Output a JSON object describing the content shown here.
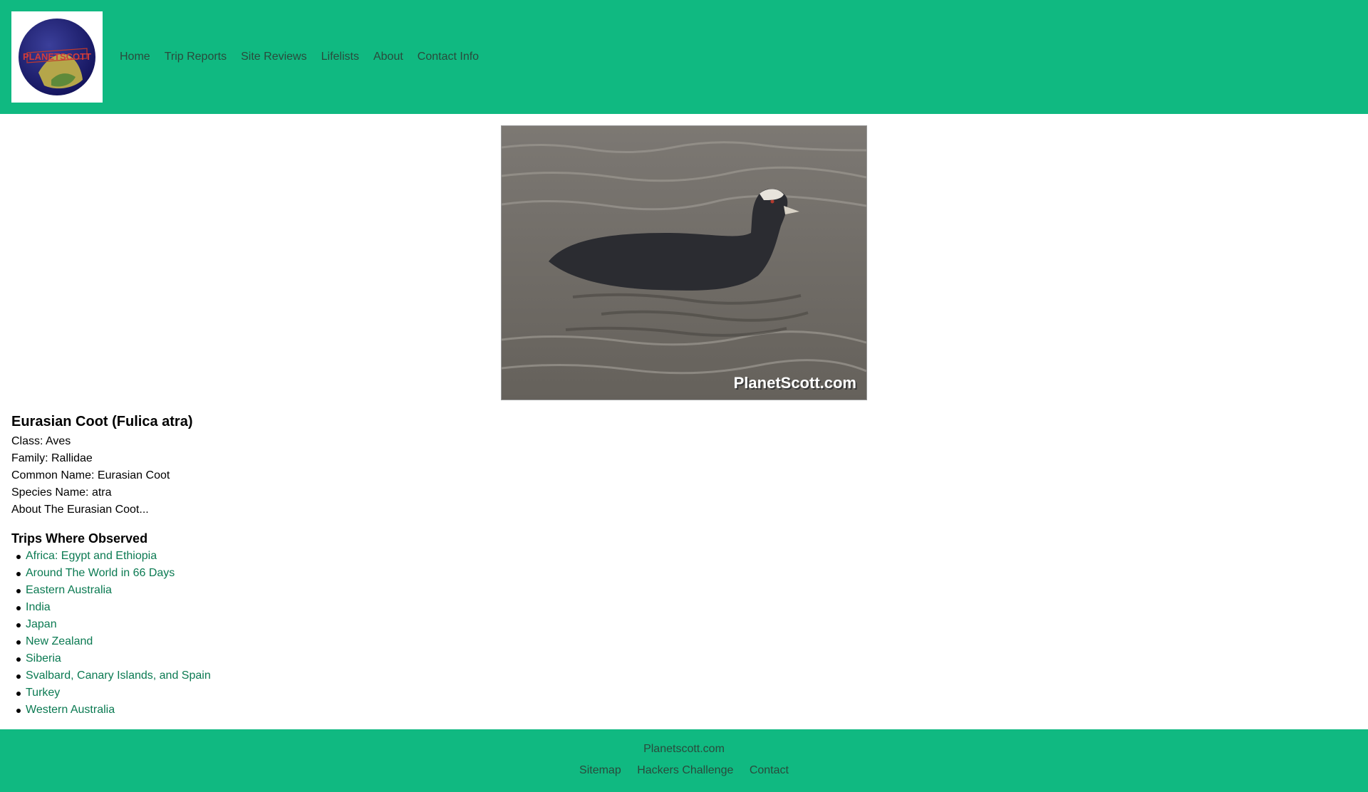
{
  "header": {
    "logo_alt": "PlanetScott",
    "nav": [
      "Home",
      "Trip Reports",
      "Site Reviews",
      "Lifelists",
      "About",
      "Contact Info"
    ]
  },
  "photo": {
    "alt": "Eurasian Coot",
    "watermark": "PlanetScott.com"
  },
  "species": {
    "title": "Eurasian Coot (Fulica atra)",
    "class": "Class: Aves",
    "family": "Family: Rallidae",
    "common_name": "Common Name: Eurasian Coot",
    "species_name": "Species Name: atra",
    "about": "About The Eurasian Coot..."
  },
  "trips": {
    "title": "Trips Where Observed",
    "items": [
      "Africa: Egypt and Ethiopia",
      "Around The World in 66 Days",
      "Eastern Australia",
      "India",
      "Japan",
      "New Zealand",
      "Siberia",
      "Svalbard, Canary Islands, and Spain",
      "Turkey",
      "Western Australia"
    ]
  },
  "footer": {
    "site": "Planetscott.com",
    "links": [
      "Sitemap",
      "Hackers Challenge",
      "Contact"
    ]
  },
  "colors": {
    "brand_green": "#10b981",
    "link_green": "#0b7a52"
  }
}
